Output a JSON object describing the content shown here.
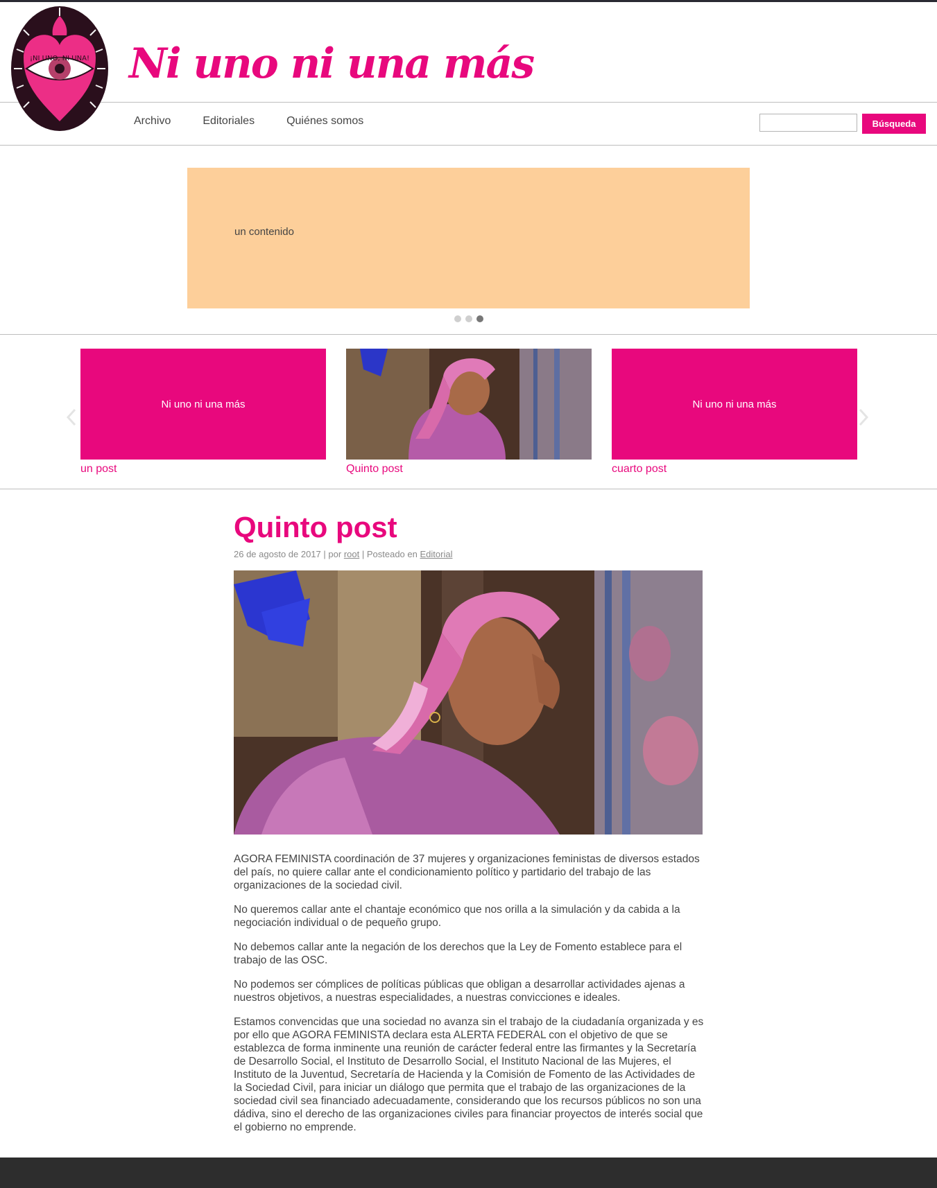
{
  "site": {
    "title": "Ni uno ni una más",
    "logo_text": "¡NI UNO, NI UNA!"
  },
  "nav": {
    "items": [
      {
        "label": "Archivo"
      },
      {
        "label": "Editoriales"
      },
      {
        "label": "Quiénes somos"
      }
    ]
  },
  "search": {
    "placeholder": "",
    "button_label": "Búsqueda"
  },
  "hero": {
    "text": "un contenido",
    "slide_count": 3,
    "active_slide": 3
  },
  "carousel": {
    "cards": [
      {
        "box_text": "Ni uno ni una más",
        "title": "un post"
      },
      {
        "box_text": "",
        "title": "Quinto post"
      },
      {
        "box_text": "Ni uno ni una más",
        "title": "cuarto post"
      }
    ]
  },
  "post": {
    "title": "Quinto post",
    "date": "26 de agosto de 2017",
    "by_label": "por",
    "author": "root",
    "posted_label": "Posteado en",
    "category": "Editorial",
    "paragraphs": [
      "AGORA FEMINISTA coordinación de 37 mujeres y organizaciones feministas de diversos estados del país, no quiere callar ante el condicionamiento político y partidario del trabajo de las organizaciones de la sociedad civil.",
      "No queremos callar ante el chantaje económico que nos orilla a la simulación y da cabida a la negociación individual o de pequeño grupo.",
      "No debemos callar ante la negación de los derechos que la Ley de Fomento establece para el trabajo de las OSC.",
      "No podemos ser cómplices de políticas públicas que obligan a desarrollar actividades ajenas a nuestros objetivos, a nuestras especialidades, a nuestras convicciones e ideales.",
      "Estamos convencidas que una sociedad no avanza sin el trabajo de la ciudadanía organizada y es por ello que AGORA FEMINISTA declara esta ALERTA FEDERAL con el objetivo de que se establezca de forma inminente una reunión de carácter federal entre las firmantes y la Secretaría de Desarrollo Social, el Instituto de Desarrollo Social, el Instituto Nacional de las Mujeres, el Instituto de la Juventud, Secretaría de Hacienda y la Comisión de Fomento de las Actividades de la Sociedad Civil, para iniciar un diálogo que permita que el trabajo de las organizaciones de la sociedad civil sea financiado adecuadamente, considerando que los recursos públicos no son una dádiva, sino el derecho de las organizaciones civiles para financiar proyectos de interés social que el gobierno no emprende."
    ]
  },
  "colors": {
    "brand": "#e8087d",
    "hero_bg": "#fdcf9a",
    "footer_bg": "#2d2d2d",
    "text": "#444444"
  },
  "icons": {
    "carousel_prev": "chevron-left-icon",
    "carousel_next": "chevron-right-icon"
  }
}
